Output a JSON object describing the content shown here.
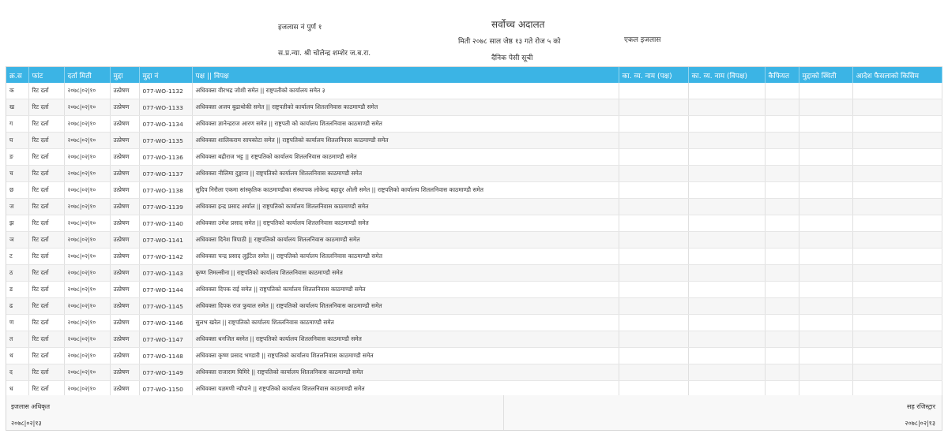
{
  "header": {
    "bench_no": "इजलास नं पुर्ण १",
    "judge": "स.प्र.न्या. श्री चोलेन्द्र शम्शेर ज.ब.रा.",
    "court_name": "सर्वोच्च अदालत",
    "date_line": "मिती २०७८ साल जेष्ठ १३ गते रोज ५ को",
    "list_title": "दैनिक पेसी सूची",
    "bench_type": "एकल इजलास"
  },
  "table": {
    "columns": [
      "क्र.स",
      "फांट",
      "दर्ता मिती",
      "मुद्दा",
      "मुद्दा नं",
      "पक्ष || विपक्ष",
      "का. व्य. नाम (पक्ष)",
      "का. व्य. नाम (विपक्ष)",
      "कैफियत",
      "मुद्दाको स्थिती",
      "आदेश फैसलाको किसिम"
    ],
    "rows": [
      {
        "sn": "क",
        "font": "रिट दर्ता",
        "date": "२०७८|०२|१०",
        "case": "उत्प्रेषण",
        "case_no": "077-WO-1132",
        "parties": "अधिवक्ता वीरभद्र जोशी समेत || राष्ट्रपतीको कार्यालय समेत ३"
      },
      {
        "sn": "ख",
        "font": "रिट दर्ता",
        "date": "२०७८|०२|१०",
        "case": "उत्प्रेषण",
        "case_no": "077-WO-1133",
        "parties": "अधिवक्ता अजय बुढाथोकी समेत || राष्ट्रपतीको कार्यालय शितलनिवास काठमाण्डौ समेत"
      },
      {
        "sn": "ग",
        "font": "रिट दर्ता",
        "date": "२०७८|०२|१०",
        "case": "उत्प्रेषण",
        "case_no": "077-WO-1134",
        "parties": "अधिवक्ता ज्ञानेन्द्रराज आरण समेत || राष्ट्रपती को कार्यालय शितलनिवास काठमाण्डौ समेत"
      },
      {
        "sn": "घ",
        "font": "रिट दर्ता",
        "date": "२०७८|०२|१०",
        "case": "उत्प्रेषण",
        "case_no": "077-WO-1135",
        "parties": "अधिवक्ता शालिकराम सापकोटा समेत || राष्ट्रपतिको कार्यालय शितलनिवास काठमाण्डौ समेत"
      },
      {
        "sn": "ङ",
        "font": "रिट दर्ता",
        "date": "२०७८|०२|१०",
        "case": "उत्प्रेषण",
        "case_no": "077-WO-1136",
        "parties": "अधिवक्ता बद्रीराज भट्ट || राष्ट्रपतिको कार्यालय शितलनिवास काठमाण्डौ समेत"
      },
      {
        "sn": "च",
        "font": "रिट दर्ता",
        "date": "२०७८|०२|१०",
        "case": "उत्प्रेषण",
        "case_no": "077-WO-1137",
        "parties": "अधिवक्ता नीलिमा दुङ्गाना || राष्ट्रपतिको कार्यालय शितलनिवास काठमाण्डौ समेत"
      },
      {
        "sn": "छ",
        "font": "रिट दर्ता",
        "date": "२०७८|०२|१०",
        "case": "उत्प्रेषण",
        "case_no": "077-WO-1138",
        "parties": "सुदिप निरौला एकमा सांस्कृतिक काठमाण्डौका संस्थापक लोकेन्द्र बहादुर ओली समेत || राष्ट्रपतिको कार्यालय शितलनिवास काठमाण्डौ समेत"
      },
      {
        "sn": "ज",
        "font": "रिट दर्ता",
        "date": "२०७८|०२|१०",
        "case": "उत्प्रेषण",
        "case_no": "077-WO-1139",
        "parties": "अधिवक्ता इन्द्र प्रसाद अर्याल || राष्ट्रपतिको कार्यालय शितलनिवास काठमाण्डौ समेत"
      },
      {
        "sn": "झ",
        "font": "रिट दर्ता",
        "date": "२०७८|०२|१०",
        "case": "उत्प्रेषण",
        "case_no": "077-WO-1140",
        "parties": "अधिवक्ता उमेश प्रसाद समेत || राष्ट्रपतिको कार्यालय शितलनिवास काठमाण्डौ समेत"
      },
      {
        "sn": "ञ",
        "font": "रिट दर्ता",
        "date": "२०७८|०२|१०",
        "case": "उत्प्रेषण",
        "case_no": "077-WO-1141",
        "parties": "अधिवक्ता दिनेश त्रिपाठी || राष्ट्रपतिको कार्यालय शितलनिवास काठमाण्डौ समेत"
      },
      {
        "sn": "ट",
        "font": "रिट दर्ता",
        "date": "२०७८|०२|१०",
        "case": "उत्प्रेषण",
        "case_no": "077-WO-1142",
        "parties": "अधिवक्ता चन्द्र प्रसाद लुइँटेल समेत || राष्ट्रपतिको कार्यालय शितलनिवास काठमाण्डौ समेत"
      },
      {
        "sn": "ठ",
        "font": "रिट दर्ता",
        "date": "२०७८|०२|१०",
        "case": "उत्प्रेषण",
        "case_no": "077-WO-1143",
        "parties": "कृष्ण तिमल्सीना || राष्ट्रपतिको कार्यालय शितलनिवास काठमाण्डौ समेत"
      },
      {
        "sn": "ड",
        "font": "रिट दर्ता",
        "date": "२०७८|०२|१०",
        "case": "उत्प्रेषण",
        "case_no": "077-WO-1144",
        "parties": "अधिवक्ता दिपक राई समेत || राष्ट्रपतिको कार्यालय शितलनिवास काठमाण्डौ समेत"
      },
      {
        "sn": "ढ",
        "font": "रिट दर्ता",
        "date": "२०७८|०२|१०",
        "case": "उत्प्रेषण",
        "case_no": "077-WO-1145",
        "parties": "अधिवक्ता दिपक राज फुयाल समेत || राष्ट्रपतिको कार्यालय शितलनिवास काठमाण्डौ समेत"
      },
      {
        "sn": "ण",
        "font": "रिट दर्ता",
        "date": "२०७८|०२|१०",
        "case": "उत्प्रेषण",
        "case_no": "077-WO-1146",
        "parties": "सुलभ खरेल || राष्ट्रपतिको कार्यालय शितलनिवास काठमाण्डौ समेत"
      },
      {
        "sn": "त",
        "font": "रिट दर्ता",
        "date": "२०७८|०२|१०",
        "case": "उत्प्रेषण",
        "case_no": "077-WO-1147",
        "parties": "अधिवक्ता धनजित बस्नेत || राष्ट्रपतिको कार्यालय शितलनिवास काठमाण्डौ समेत"
      },
      {
        "sn": "थ",
        "font": "रिट दर्ता",
        "date": "२०७८|०२|१०",
        "case": "उत्प्रेषण",
        "case_no": "077-WO-1148",
        "parties": "अधिवक्ता कृष्ण प्रसाद भण्डारी || राष्ट्रपतिको कार्यालय शितलनिवास काठमाण्डौ समेत"
      },
      {
        "sn": "द",
        "font": "रिट दर्ता",
        "date": "२०७८|०२|१०",
        "case": "उत्प्रेषण",
        "case_no": "077-WO-1149",
        "parties": "अधिवक्ता राजाराम घिमिरे || राष्ट्रपतिको कार्यालय शितलनिवास काठमाण्डौ समेत"
      },
      {
        "sn": "ध",
        "font": "रिट दर्ता",
        "date": "२०७८|०२|१०",
        "case": "उत्प्रेषण",
        "case_no": "077-WO-1150",
        "parties": "अधिवक्ता यज्ञमणी न्यौपाने || राष्ट्रपतिको कार्यालय शितलनिवास काठमाण्डौ समेत"
      }
    ]
  },
  "footer": {
    "left_label": "इजलास अधिकृत",
    "left_date": "२०७८|०२|१३",
    "right_label": "सह रजिस्ट्रार",
    "right_date": "२०७८|०२|१३"
  },
  "colors": {
    "header_bg": "#3bb4e5",
    "header_text": "#ffffff",
    "stripe": "#f6f6f6"
  }
}
